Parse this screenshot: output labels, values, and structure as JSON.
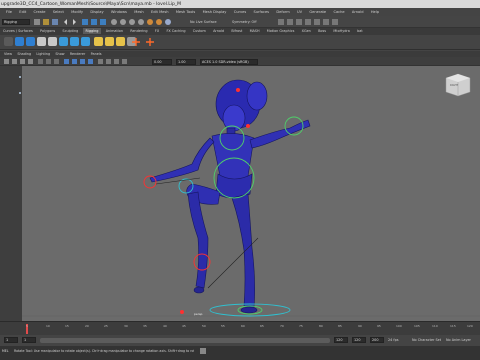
{
  "title": "upgrade3D_CC4_Cartoon_WomanMesh\\Source\\Maya\\Scn\\maya.mb   -   lovel.Lip_M",
  "menus": [
    "File",
    "Edit",
    "Create",
    "Select",
    "Modify",
    "Display",
    "Windows",
    "Mesh",
    "Edit Mesh",
    "Mesh Tools",
    "Mesh Display",
    "Curves",
    "Surfaces",
    "Deform",
    "UV",
    "Generate",
    "Cache",
    "Arnold",
    "Help"
  ],
  "toolbar": {
    "mode": "Rigging",
    "no_live_surface": "No Live Surface",
    "symmetry": "Symmetry: Off"
  },
  "shelf_tabs": [
    "Curves / Surfaces",
    "Polygons",
    "Sculpting",
    "Rigging",
    "Animation",
    "Rendering",
    "FX",
    "FX Caching",
    "Custom",
    "Arnold",
    "Bifrost",
    "MASH",
    "Motion Graphics",
    "XGen",
    "Boss",
    "MtoHydra",
    "bat"
  ],
  "active_shelf_tab": "Rigging",
  "panel_menu": [
    "View",
    "Shading",
    "Lighting",
    "Show",
    "Renderer",
    "Panels"
  ],
  "viewport": {
    "field_a": "0.00",
    "field_b": "1.00",
    "color_space": "ACES 1.0 SDR-video (sRGB)",
    "camera_label": "persp",
    "viewcube_label": "RIGHT"
  },
  "timeline_ticks": [
    "5",
    "10",
    "15",
    "20",
    "25",
    "30",
    "35",
    "40",
    "45",
    "50",
    "55",
    "60",
    "65",
    "70",
    "75",
    "80",
    "85",
    "90",
    "95",
    "100",
    "105",
    "110",
    "115",
    "120"
  ],
  "range": {
    "start": "1",
    "start_inner": "1",
    "end_inner": "120",
    "end": "120",
    "end_total": "200",
    "character_set": "No Character Set",
    "anim_layer": "No Anim Layer",
    "fps": "24 fps"
  },
  "help_text": "Rotate Tool: Use manipulator to rotate object(s). Ctrl+drag manipulator to change rotation axis. Shift+drag to rotate components along normals.",
  "mel_label": "MEL",
  "colors": {
    "viewport_bg": "#6b6b6b",
    "wire": "#2020a0",
    "control_green": "#4fd06a",
    "control_red": "#ff3030",
    "control_cyan": "#30c0d0"
  }
}
